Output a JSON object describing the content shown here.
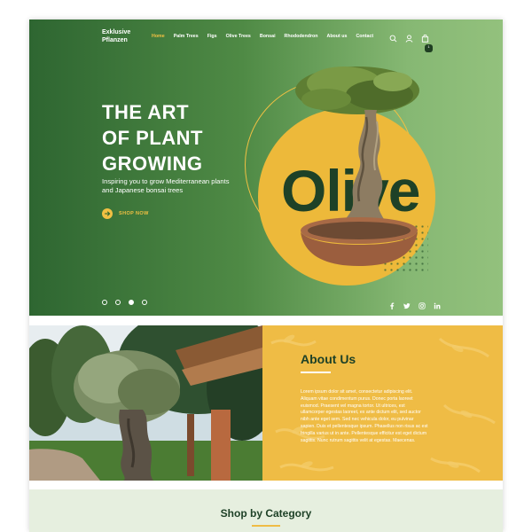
{
  "brand": {
    "line1": "Exklusive",
    "line2": "Pflanzen"
  },
  "nav": {
    "items": [
      {
        "label": "Home",
        "active": true
      },
      {
        "label": "Palm Trees"
      },
      {
        "label": "Figs"
      },
      {
        "label": "Olive Trees"
      },
      {
        "label": "Bonsai"
      },
      {
        "label": "Rhododendron"
      },
      {
        "label": "About us"
      },
      {
        "label": "Contact"
      }
    ],
    "icons": [
      "search-icon",
      "user-icon",
      "cart-icon"
    ],
    "cart_count": "1"
  },
  "hero": {
    "title_lines": [
      "THE ART",
      "OF PLANT",
      "GROWING"
    ],
    "subtitle": "Inspiring you to grow Mediterranean plants and Japanese bonsai trees",
    "cta": "SHOP NOW",
    "feature_word": "Olive",
    "slides": 4,
    "active_slide": 3,
    "social": [
      "facebook-icon",
      "twitter-icon",
      "instagram-icon",
      "linkedin-icon"
    ]
  },
  "about": {
    "title": "About Us",
    "body": "Lorem ipsum dolor sit amet, consectetur adipiscing elit. Aliquam vitae condimentum purus. Donec porta laoreet euismod. Praesent vel magna tortor. Ut ultrices, est ullamcorper egestas laoreet, ex ante dictum elit, sed auctor nibh ante eget sem. Sed nec vehicula dolor, eu pulvinar sapien. Duis et pellentesque ipsum. Phasellus non risus ac est fringilla varius ut in ante. Pellentesque efficitur est eget dictum sagittis. Nunc rutrum sagittis velit at egestas. Maecenas."
  },
  "category": {
    "title": "Shop by Category"
  },
  "colors": {
    "accent": "#f1c043",
    "dark_green": "#1e4127",
    "hero_start": "#2e6631",
    "hero_end": "#93c17d",
    "about_bg": "#efbc45",
    "category_bg": "#e6efdf"
  }
}
